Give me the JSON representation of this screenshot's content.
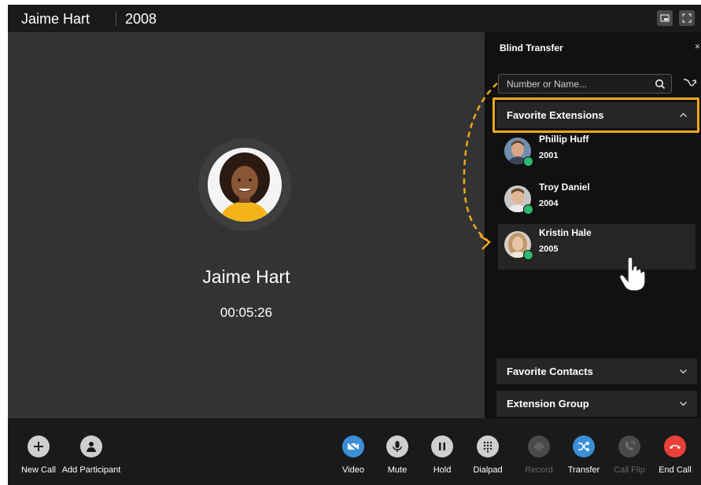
{
  "window": {
    "caller_title": "Jaime Hart",
    "extension_title": "2008"
  },
  "call": {
    "caller_name": "Jaime Hart",
    "duration": "00:05:26"
  },
  "transfer_panel": {
    "title": "Blind Transfer",
    "close_glyph": "×",
    "search_placeholder": "Number or Name...",
    "sections": {
      "favorite_extensions": "Favorite Extensions",
      "favorite_contacts": "Favorite Contacts",
      "extension_group": "Extension Group"
    },
    "favorites": [
      {
        "name": "Phillip Huff",
        "number": "2001",
        "status": "available"
      },
      {
        "name": "Troy Daniel",
        "number": "2004",
        "status": "available"
      },
      {
        "name": "Kristin Hale",
        "number": "2005",
        "status": "available"
      }
    ]
  },
  "toolbar": {
    "new_call": "New Call",
    "add_participant": "Add Participant",
    "video": "Video",
    "mute": "Mute",
    "hold": "Hold",
    "dialpad": "Dialpad",
    "record": "Record",
    "transfer": "Transfer",
    "call_flip": "Call Flip",
    "end_call": "End Call"
  },
  "colors": {
    "highlight": "#f0a81c",
    "accent_blue": "#3a8fd6",
    "end_call_red": "#e9403a",
    "status_green": "#2eb872"
  }
}
